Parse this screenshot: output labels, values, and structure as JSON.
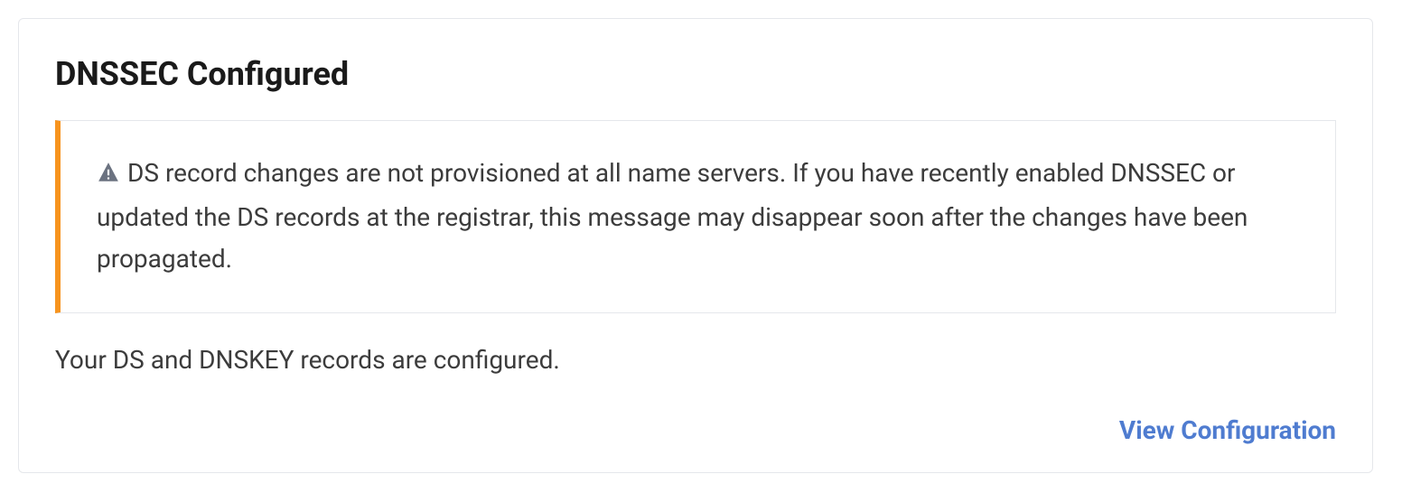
{
  "card": {
    "title": "DNSSEC Configured",
    "alert": {
      "icon_name": "warning",
      "message": "DS record changes are not provisioned at all name servers. If you have recently enabled DNSSEC or updated the DS records at the registrar, this message may disappear soon after the changes have been propagated."
    },
    "description": "Your DS and DNSKEY records are configured.",
    "actions": {
      "view_configuration_label": "View Configuration"
    }
  },
  "colors": {
    "alert_accent": "#f7941e",
    "link": "#4f7cd0",
    "icon": "#6b7280"
  }
}
